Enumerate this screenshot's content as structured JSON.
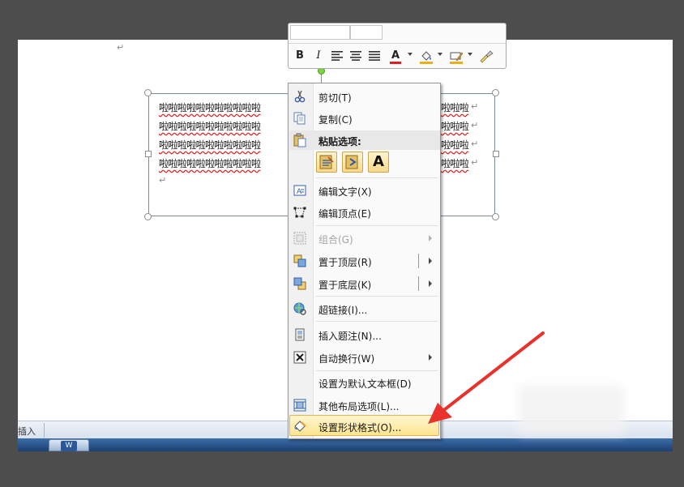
{
  "document": {
    "para_mark": "↵",
    "textbox_lines": [
      "啦啦啦啦啦啦啦啦啦啦啦",
      "啦啦啦啦啦啦啦啦啦啦啦",
      "啦啦啦啦啦啦啦啦啦啦啦",
      "啦啦啦啦啦啦啦啦啦啦啦"
    ],
    "textbox_lines_right": [
      "啦啦啦",
      "啦啦啦",
      "啦啦啦",
      "啦啦啦"
    ]
  },
  "status_bar": {
    "label": "插入"
  },
  "taskbar": {
    "app_icon_text": "W"
  },
  "mini_toolbar": {
    "bold": "B",
    "italic": "I",
    "font_color": "A",
    "colors": {
      "font": "#e02020",
      "highlight": "#e8b018"
    }
  },
  "context_menu": {
    "items": [
      {
        "label": "剪切(T)",
        "icon": "scissors-icon"
      },
      {
        "label": "复制(C)",
        "icon": "copy-icon"
      },
      {
        "label": "编辑文字(X)",
        "icon": "edit-text-icon"
      },
      {
        "label": "编辑顶点(E)",
        "icon": "edit-points-icon"
      },
      {
        "label": "组合(G)",
        "icon": "group-icon"
      },
      {
        "label": "置于顶层(R)",
        "icon": "bring-front-icon"
      },
      {
        "label": "置于底层(K)",
        "icon": "send-back-icon"
      },
      {
        "label": "超链接(I)...",
        "icon": "hyperlink-icon"
      },
      {
        "label": "插入题注(N)...",
        "icon": "caption-icon"
      },
      {
        "label": "自动换行(W)",
        "icon": "wrap-text-icon"
      },
      {
        "label": "设置为默认文本框(D)",
        "icon": ""
      },
      {
        "label": "其他布局选项(L)...",
        "icon": "layout-options-icon"
      },
      {
        "label": "设置形状格式(O)...",
        "icon": "format-shape-icon"
      }
    ],
    "paste_header": "粘贴选项:",
    "paste_keep_text": "A"
  },
  "colors": {
    "accent_red": "#e8322b",
    "menu_highlight": "#fde592"
  }
}
